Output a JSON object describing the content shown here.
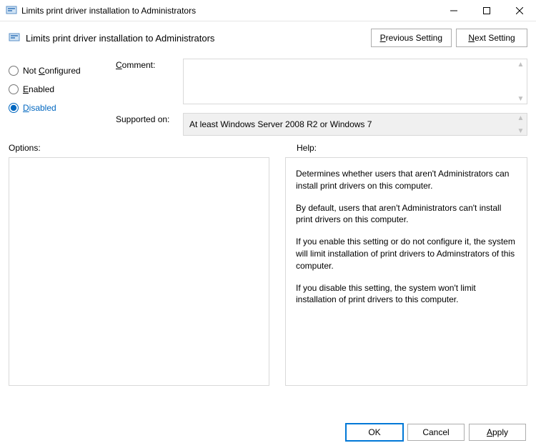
{
  "window": {
    "title": "Limits print driver installation to Administrators"
  },
  "header": {
    "title": "Limits print driver installation to Administrators",
    "prev": "Previous Setting",
    "next": "Next Setting"
  },
  "radios": {
    "not_configured": "Not Configured",
    "enabled": "Enabled",
    "disabled": "Disabled",
    "selected": "disabled"
  },
  "fields": {
    "comment_label": "Comment:",
    "comment_value": "",
    "supported_label": "Supported on:",
    "supported_value": "At least Windows Server 2008 R2 or Windows 7"
  },
  "panels": {
    "options_label": "Options:",
    "help_label": "Help:"
  },
  "help_text": {
    "p1": "Determines whether users that aren't Administrators can install print drivers on this computer.",
    "p2": "By default, users that aren't Administrators can't install print drivers on this computer.",
    "p3": "If you enable this setting or do not configure it, the system will limit installation of print drivers to Adminstrators of this computer.",
    "p4": "If you disable this setting, the system won't limit installation of print drivers to this computer."
  },
  "footer": {
    "ok": "OK",
    "cancel": "Cancel",
    "apply": "Apply"
  }
}
